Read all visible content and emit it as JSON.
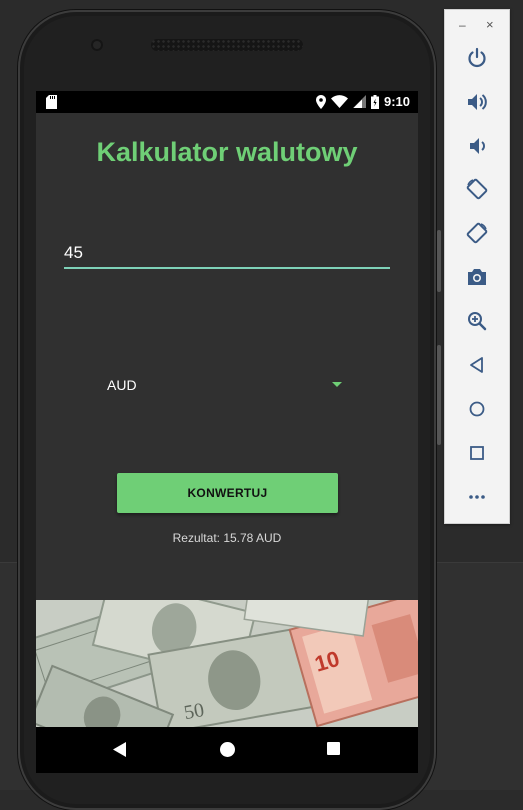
{
  "status_bar": {
    "time": "9:10",
    "icons": [
      "sd-card-icon",
      "location-icon",
      "wifi-icon",
      "signal-icon",
      "battery-icon"
    ]
  },
  "app": {
    "title": "Kalkulator walutowy",
    "amount_value": "45",
    "currency_selected": "AUD",
    "convert_button_label": "KONWERTUJ",
    "result_text": "Rezultat: 15.78 AUD",
    "accent_color": "#6fcf76"
  },
  "nav_bar": {
    "buttons": [
      "back-icon",
      "home-icon",
      "recents-icon"
    ]
  },
  "emulator_toolbar": {
    "minimize_label": "–",
    "close_label": "×",
    "buttons": [
      "power-icon",
      "volume-up-icon",
      "volume-down-icon",
      "rotate-left-icon",
      "rotate-right-icon",
      "camera-icon",
      "zoom-icon",
      "back-icon",
      "home-icon",
      "overview-icon",
      "more-icon"
    ]
  }
}
